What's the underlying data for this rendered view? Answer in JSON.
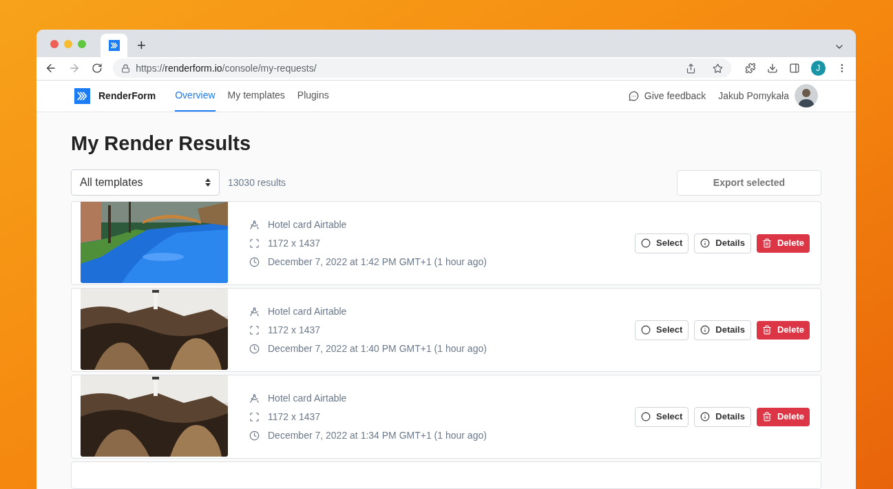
{
  "browser": {
    "tab": {
      "selected": true
    },
    "url": {
      "scheme": "https://",
      "host": "renderform.io",
      "path": "/console/my-requests/"
    },
    "profile_initial": "J",
    "new_tab": "+"
  },
  "nav": {
    "brand": "RenderForm",
    "items": [
      {
        "label": "Overview",
        "selected": true
      },
      {
        "label": "My templates",
        "selected": false
      },
      {
        "label": "Plugins",
        "selected": false
      }
    ],
    "feedback": "Give feedback",
    "user": "Jakub Pomykała"
  },
  "page": {
    "title": "My Render Results",
    "filter": {
      "value": "All templates"
    },
    "count": "13030 results",
    "export_button": "Export selected"
  },
  "results": [
    {
      "template": "Hotel card Airtable",
      "size": "1172 x 1437",
      "date": "December 7, 2022 at 1:42 PM GMT+1 (1 hour ago)",
      "selected": false,
      "actions": {
        "select": "Select",
        "details": "Details",
        "delete": "Delete"
      }
    },
    {
      "template": "Hotel card Airtable",
      "size": "1172 x 1437",
      "date": "December 7, 2022 at 1:40 PM GMT+1 (1 hour ago)",
      "selected": false,
      "actions": {
        "select": "Select",
        "details": "Details",
        "delete": "Delete"
      }
    },
    {
      "template": "Hotel card Airtable",
      "size": "1172 x 1437",
      "date": "December 7, 2022 at 1:34 PM GMT+1 (1 hour ago)",
      "selected": false,
      "actions": {
        "select": "Select",
        "details": "Details",
        "delete": "Delete"
      }
    }
  ]
}
